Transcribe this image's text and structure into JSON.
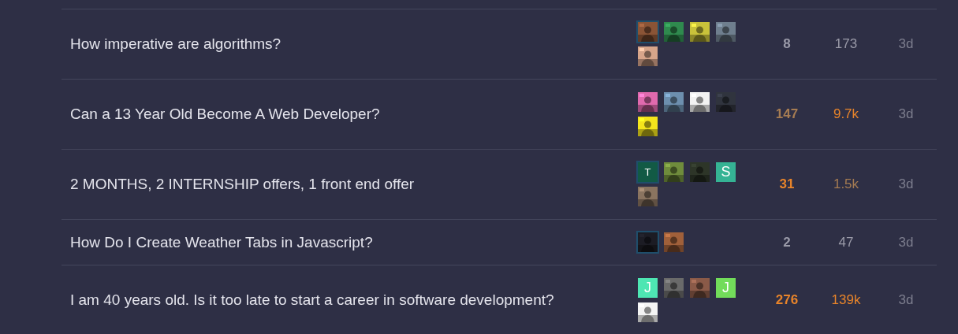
{
  "topics": [
    {
      "title": "How imperative are algorithms?",
      "posters": [
        {
          "kind": "picture",
          "color": "#8a5436",
          "highlighted": true
        },
        {
          "kind": "picture",
          "color": "#2f8a4e",
          "highlighted": false
        },
        {
          "kind": "picture",
          "color": "#c9c23a",
          "highlighted": false
        },
        {
          "kind": "picture",
          "color": "#6f7f8e",
          "highlighted": false
        },
        {
          "kind": "picture",
          "color": "#d7a58a",
          "highlighted": false
        }
      ],
      "replies": {
        "text": "8",
        "color": "#9a9aa8"
      },
      "views": {
        "text": "173",
        "color": "#9a9aa8"
      },
      "activity": "3d"
    },
    {
      "title": "Can a 13 Year Old Become A Web Developer?",
      "posters": [
        {
          "kind": "picture",
          "color": "#e06aae",
          "highlighted": false
        },
        {
          "kind": "picture",
          "color": "#6d8fae",
          "highlighted": false
        },
        {
          "kind": "picture",
          "color": "#f2f2f2",
          "highlighted": false
        },
        {
          "kind": "picture",
          "color": "#30343e",
          "highlighted": false
        },
        {
          "kind": "picture",
          "color": "#f4e51c",
          "highlighted": false
        }
      ],
      "replies": {
        "text": "147",
        "color": "#a67c52"
      },
      "views": {
        "text": "9.7k",
        "color": "#e8842a"
      },
      "activity": "3d"
    },
    {
      "title": "2 MONTHS, 2 INTERNSHIP offers, 1 front end offer",
      "posters": [
        {
          "kind": "letter",
          "letter": "T",
          "color": "#125a45",
          "highlighted": true
        },
        {
          "kind": "picture",
          "color": "#6f8c3c",
          "highlighted": false
        },
        {
          "kind": "picture",
          "color": "#2d3528",
          "highlighted": false
        },
        {
          "kind": "letter",
          "letter": "S",
          "color": "#35b394",
          "highlighted": false
        },
        {
          "kind": "picture",
          "color": "#8a7460",
          "highlighted": false
        }
      ],
      "replies": {
        "text": "31",
        "color": "#e8842a"
      },
      "views": {
        "text": "1.5k",
        "color": "#a67c52"
      },
      "activity": "3d"
    },
    {
      "title": "How Do I Create Weather Tabs in Javascript?",
      "posters": [
        {
          "kind": "picture",
          "color": "#1c1c24",
          "highlighted": true
        },
        {
          "kind": "picture",
          "color": "#a0603a",
          "highlighted": false
        }
      ],
      "replies": {
        "text": "2",
        "color": "#9a9aa8"
      },
      "views": {
        "text": "47",
        "color": "#9a9aa8"
      },
      "activity": "3d"
    },
    {
      "title": "I am 40 years old. Is it too late to start a career in software development?",
      "posters": [
        {
          "kind": "letter",
          "letter": "J",
          "color": "#4ee6b3",
          "highlighted": false
        },
        {
          "kind": "picture",
          "color": "#6a6a6a",
          "highlighted": false
        },
        {
          "kind": "picture",
          "color": "#8a5a48",
          "highlighted": false
        },
        {
          "kind": "letter",
          "letter": "J",
          "color": "#72dc5a",
          "highlighted": false
        },
        {
          "kind": "picture",
          "color": "#f4f4f4",
          "highlighted": false
        }
      ],
      "replies": {
        "text": "276",
        "color": "#e8842a"
      },
      "views": {
        "text": "139k",
        "color": "#e8842a"
      },
      "activity": "3d"
    }
  ]
}
